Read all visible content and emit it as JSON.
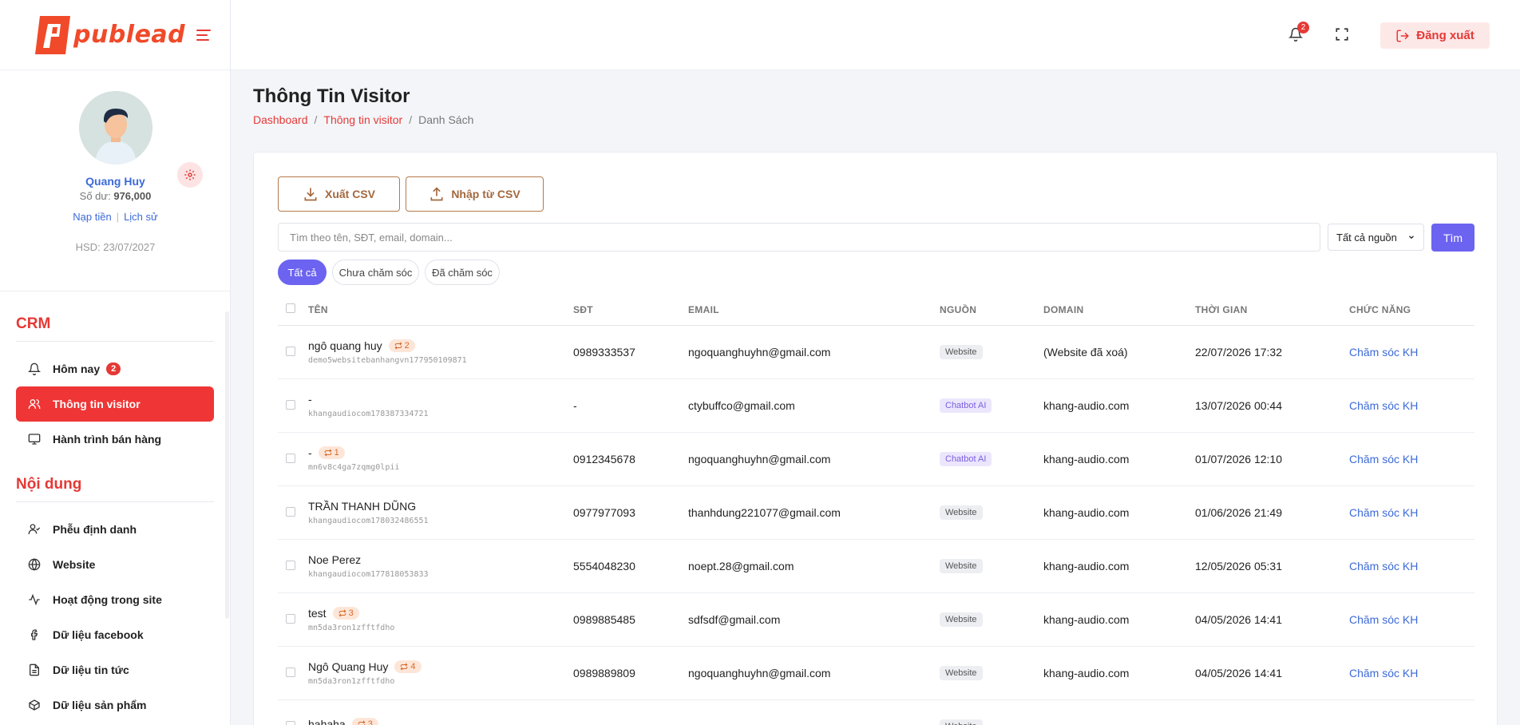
{
  "brand": {
    "name": "publead",
    "accent": "#e53935",
    "primary": "#6c63f0"
  },
  "profile": {
    "name": "Quang Huy",
    "balance_label": "Số dư:",
    "balance_value": "976,000",
    "topup": "Nạp tiền",
    "history": "Lịch sử",
    "expiry": "HSD: 23/07/2027"
  },
  "sidebar": {
    "crm_title": "CRM",
    "content_title": "Nội dung",
    "crm_items": [
      {
        "label": "Hôm nay",
        "icon": "bell-icon",
        "badge": "2"
      },
      {
        "label": "Thông tin visitor",
        "icon": "users-icon"
      },
      {
        "label": "Hành trình bán hàng",
        "icon": "monitor-icon"
      }
    ],
    "content_items": [
      {
        "label": "Phễu định danh",
        "icon": "user-check-icon"
      },
      {
        "label": "Website",
        "icon": "globe-icon"
      },
      {
        "label": "Hoạt động trong site",
        "icon": "activity-icon"
      },
      {
        "label": "Dữ liệu facebook",
        "icon": "facebook-icon"
      },
      {
        "label": "Dữ liệu tin tức",
        "icon": "file-text-icon"
      },
      {
        "label": "Dữ liệu sản phẩm",
        "icon": "box-icon"
      }
    ]
  },
  "topbar": {
    "notification_count": "2",
    "logout": "Đăng xuất"
  },
  "page": {
    "title": "Thông Tin Visitor",
    "breadcrumb": [
      "Dashboard",
      "Thông tin visitor",
      "Danh Sách"
    ]
  },
  "toolbar": {
    "export_csv": "Xuất CSV",
    "import_csv": "Nhập từ CSV",
    "search_placeholder": "Tìm theo tên, SĐT, email, domain...",
    "source_select": "Tất cả nguồn",
    "search_btn": "Tìm"
  },
  "filters": [
    "Tất cả",
    "Chưa chăm sóc",
    "Đã chăm sóc"
  ],
  "table": {
    "columns": [
      "TÊN",
      "SĐT",
      "EMAIL",
      "NGUỒN",
      "DOMAIN",
      "THỜI GIAN",
      "CHỨC NĂNG"
    ],
    "rows": [
      {
        "name": "ngô quang huy",
        "repeat": "2",
        "id": "demo5websitebanhangvn177950109871",
        "phone": "0989333537",
        "email": "ngoquanghuyhn@gmail.com",
        "source": "Website",
        "domain": "(Website đã xoá)",
        "time": "22/07/2026 17:32",
        "action": "Chăm sóc KH"
      },
      {
        "name": "-",
        "repeat": "",
        "id": "khangaudiocom178387334721",
        "phone": "-",
        "email": "ctybuffco@gmail.com",
        "source": "Chatbot AI",
        "domain": "khang-audio.com",
        "time": "13/07/2026 00:44",
        "action": "Chăm sóc KH"
      },
      {
        "name": "-",
        "repeat": "1",
        "id": "mn6v8c4ga7zqmg0lpii",
        "phone": "0912345678",
        "email": "ngoquanghuyhn@gmail.com",
        "source": "Chatbot AI",
        "domain": "khang-audio.com",
        "time": "01/07/2026 12:10",
        "action": "Chăm sóc KH"
      },
      {
        "name": "TRẦN THANH DŨNG",
        "repeat": "",
        "id": "khangaudiocom178032486551",
        "phone": "0977977093",
        "email": "thanhdung221077@gmail.com",
        "source": "Website",
        "domain": "khang-audio.com",
        "time": "01/06/2026 21:49",
        "action": "Chăm sóc KH"
      },
      {
        "name": "Noe Perez",
        "repeat": "",
        "id": "khangaudiocom177818053833",
        "phone": "5554048230",
        "email": "noept.28@gmail.com",
        "source": "Website",
        "domain": "khang-audio.com",
        "time": "12/05/2026 05:31",
        "action": "Chăm sóc KH"
      },
      {
        "name": "test",
        "repeat": "3",
        "id": "mn5da3ron1zfftfdho",
        "phone": "0989885485",
        "email": "sdfsdf@gmail.com",
        "source": "Website",
        "domain": "khang-audio.com",
        "time": "04/05/2026 14:41",
        "action": "Chăm sóc KH"
      },
      {
        "name": "Ngô Quang Huy",
        "repeat": "4",
        "id": "mn5da3ron1zfftfdho",
        "phone": "0989889809",
        "email": "ngoquanghuyhn@gmail.com",
        "source": "Website",
        "domain": "khang-audio.com",
        "time": "04/05/2026 14:41",
        "action": "Chăm sóc KH"
      },
      {
        "name": "hahaha",
        "repeat": "3",
        "id": "",
        "phone": "",
        "email": "",
        "source": "Website",
        "domain": "",
        "time": "",
        "action": ""
      }
    ]
  }
}
